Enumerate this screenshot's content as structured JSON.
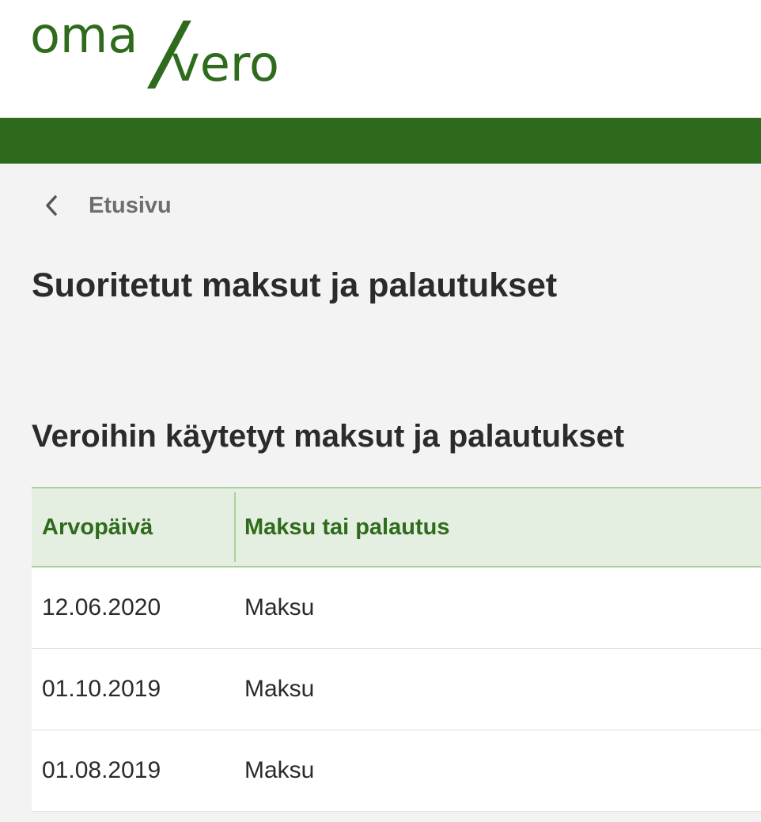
{
  "brand": {
    "logo_part1": "oma",
    "logo_part2": "vero",
    "color": "#2e6b1c",
    "bar_color": "#2d6a1c"
  },
  "breadcrumb": {
    "label": "Etusivu",
    "icon": "chevron-left-icon"
  },
  "page": {
    "title": "Suoritetut maksut ja palautukset"
  },
  "section": {
    "title": "Veroihin käytetyt maksut ja palautukset"
  },
  "table": {
    "columns": [
      "Arvopäivä",
      "Maksu tai palautus"
    ],
    "rows": [
      {
        "date": "12.06.2020",
        "type": "Maksu"
      },
      {
        "date": "01.10.2019",
        "type": "Maksu"
      },
      {
        "date": "01.08.2019",
        "type": "Maksu"
      }
    ]
  }
}
